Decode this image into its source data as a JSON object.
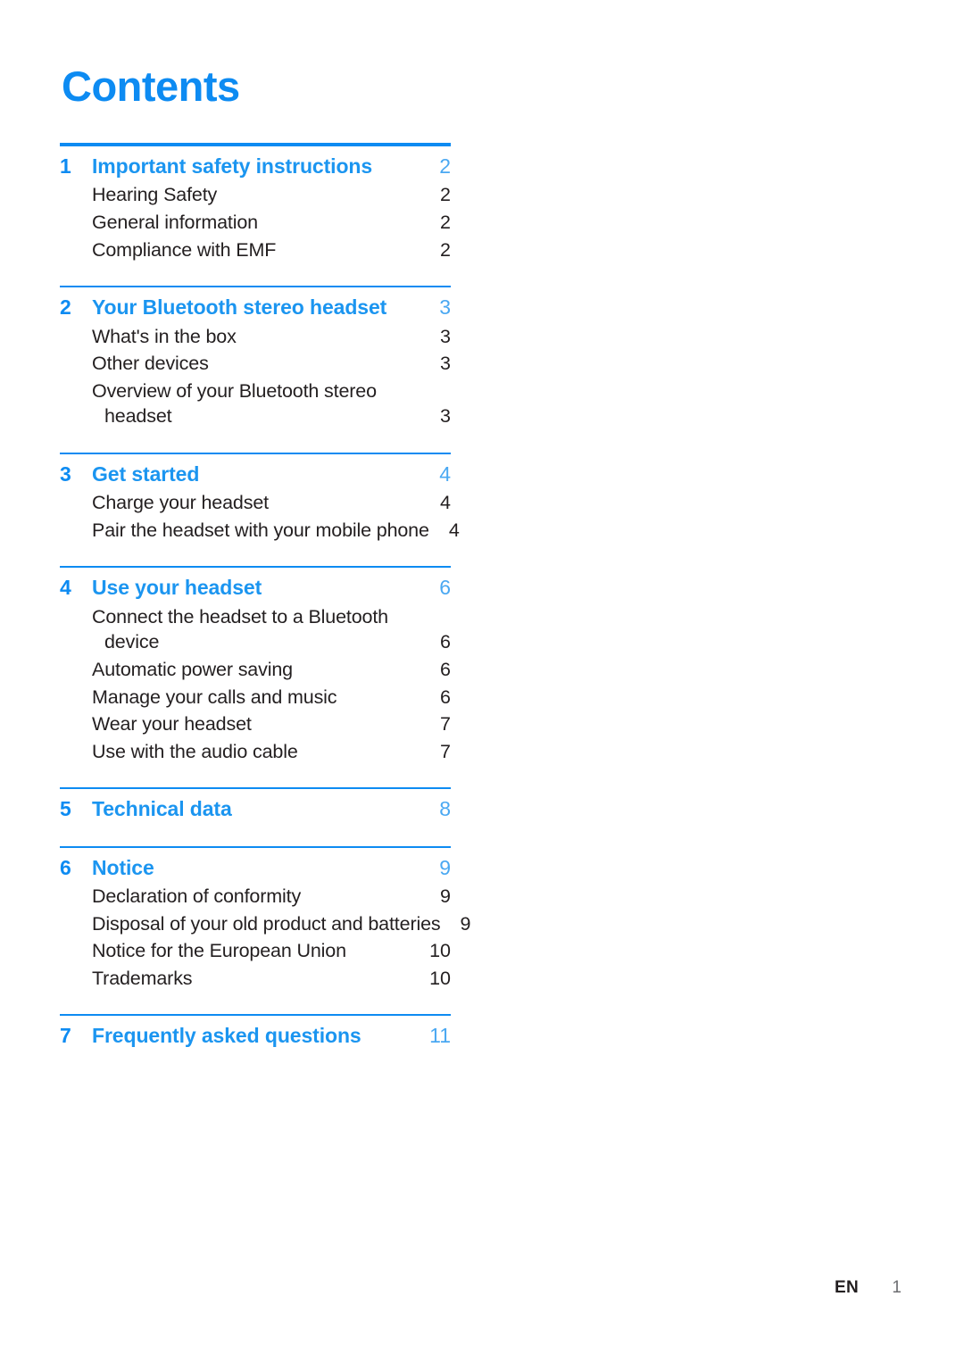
{
  "document": {
    "title": "Contents",
    "accent_color": "#0d8bf2",
    "heading_color": "#1b95f0",
    "body_text_color": "#231f20"
  },
  "toc": {
    "sections": [
      {
        "number": "1",
        "label": "Important safety instructions",
        "page": "2",
        "entries": [
          {
            "label": "Hearing Safety",
            "page": "2"
          },
          {
            "label": "General information",
            "page": "2"
          },
          {
            "label": "Compliance with EMF",
            "page": "2"
          }
        ]
      },
      {
        "number": "2",
        "label": "Your Bluetooth stereo headset",
        "page": "3",
        "entries": [
          {
            "label": "What's in the box",
            "page": "3"
          },
          {
            "label": "Other devices",
            "page": "3"
          },
          {
            "label": "Overview of your Bluetooth stereo",
            "label_cont": "headset",
            "page": "3"
          }
        ]
      },
      {
        "number": "3",
        "label": "Get started",
        "page": "4",
        "entries": [
          {
            "label": "Charge your headset",
            "page": "4"
          },
          {
            "label": "Pair the headset with your mobile phone",
            "page": "4"
          }
        ]
      },
      {
        "number": "4",
        "label": "Use your headset",
        "page": "6",
        "entries": [
          {
            "label": "Connect the headset to a Bluetooth",
            "label_cont": "device",
            "page": "6"
          },
          {
            "label": "Automatic power saving",
            "page": "6"
          },
          {
            "label": "Manage your calls and music",
            "page": "6"
          },
          {
            "label": "Wear your headset",
            "page": "7"
          },
          {
            "label": "Use with the audio cable",
            "page": "7"
          }
        ]
      },
      {
        "number": "5",
        "label": "Technical data",
        "page": "8",
        "entries": []
      },
      {
        "number": "6",
        "label": "Notice",
        "page": "9",
        "entries": [
          {
            "label": "Declaration of conformity",
            "page": "9"
          },
          {
            "label": "Disposal of your old product and batteries",
            "page": "9"
          },
          {
            "label": "Notice for the European Union",
            "page": "10"
          },
          {
            "label": "Trademarks",
            "page": "10"
          }
        ]
      },
      {
        "number": "7",
        "label": "Frequently asked questions",
        "page": "11",
        "entries": []
      }
    ]
  },
  "footer": {
    "language": "EN",
    "page_number": "1"
  }
}
